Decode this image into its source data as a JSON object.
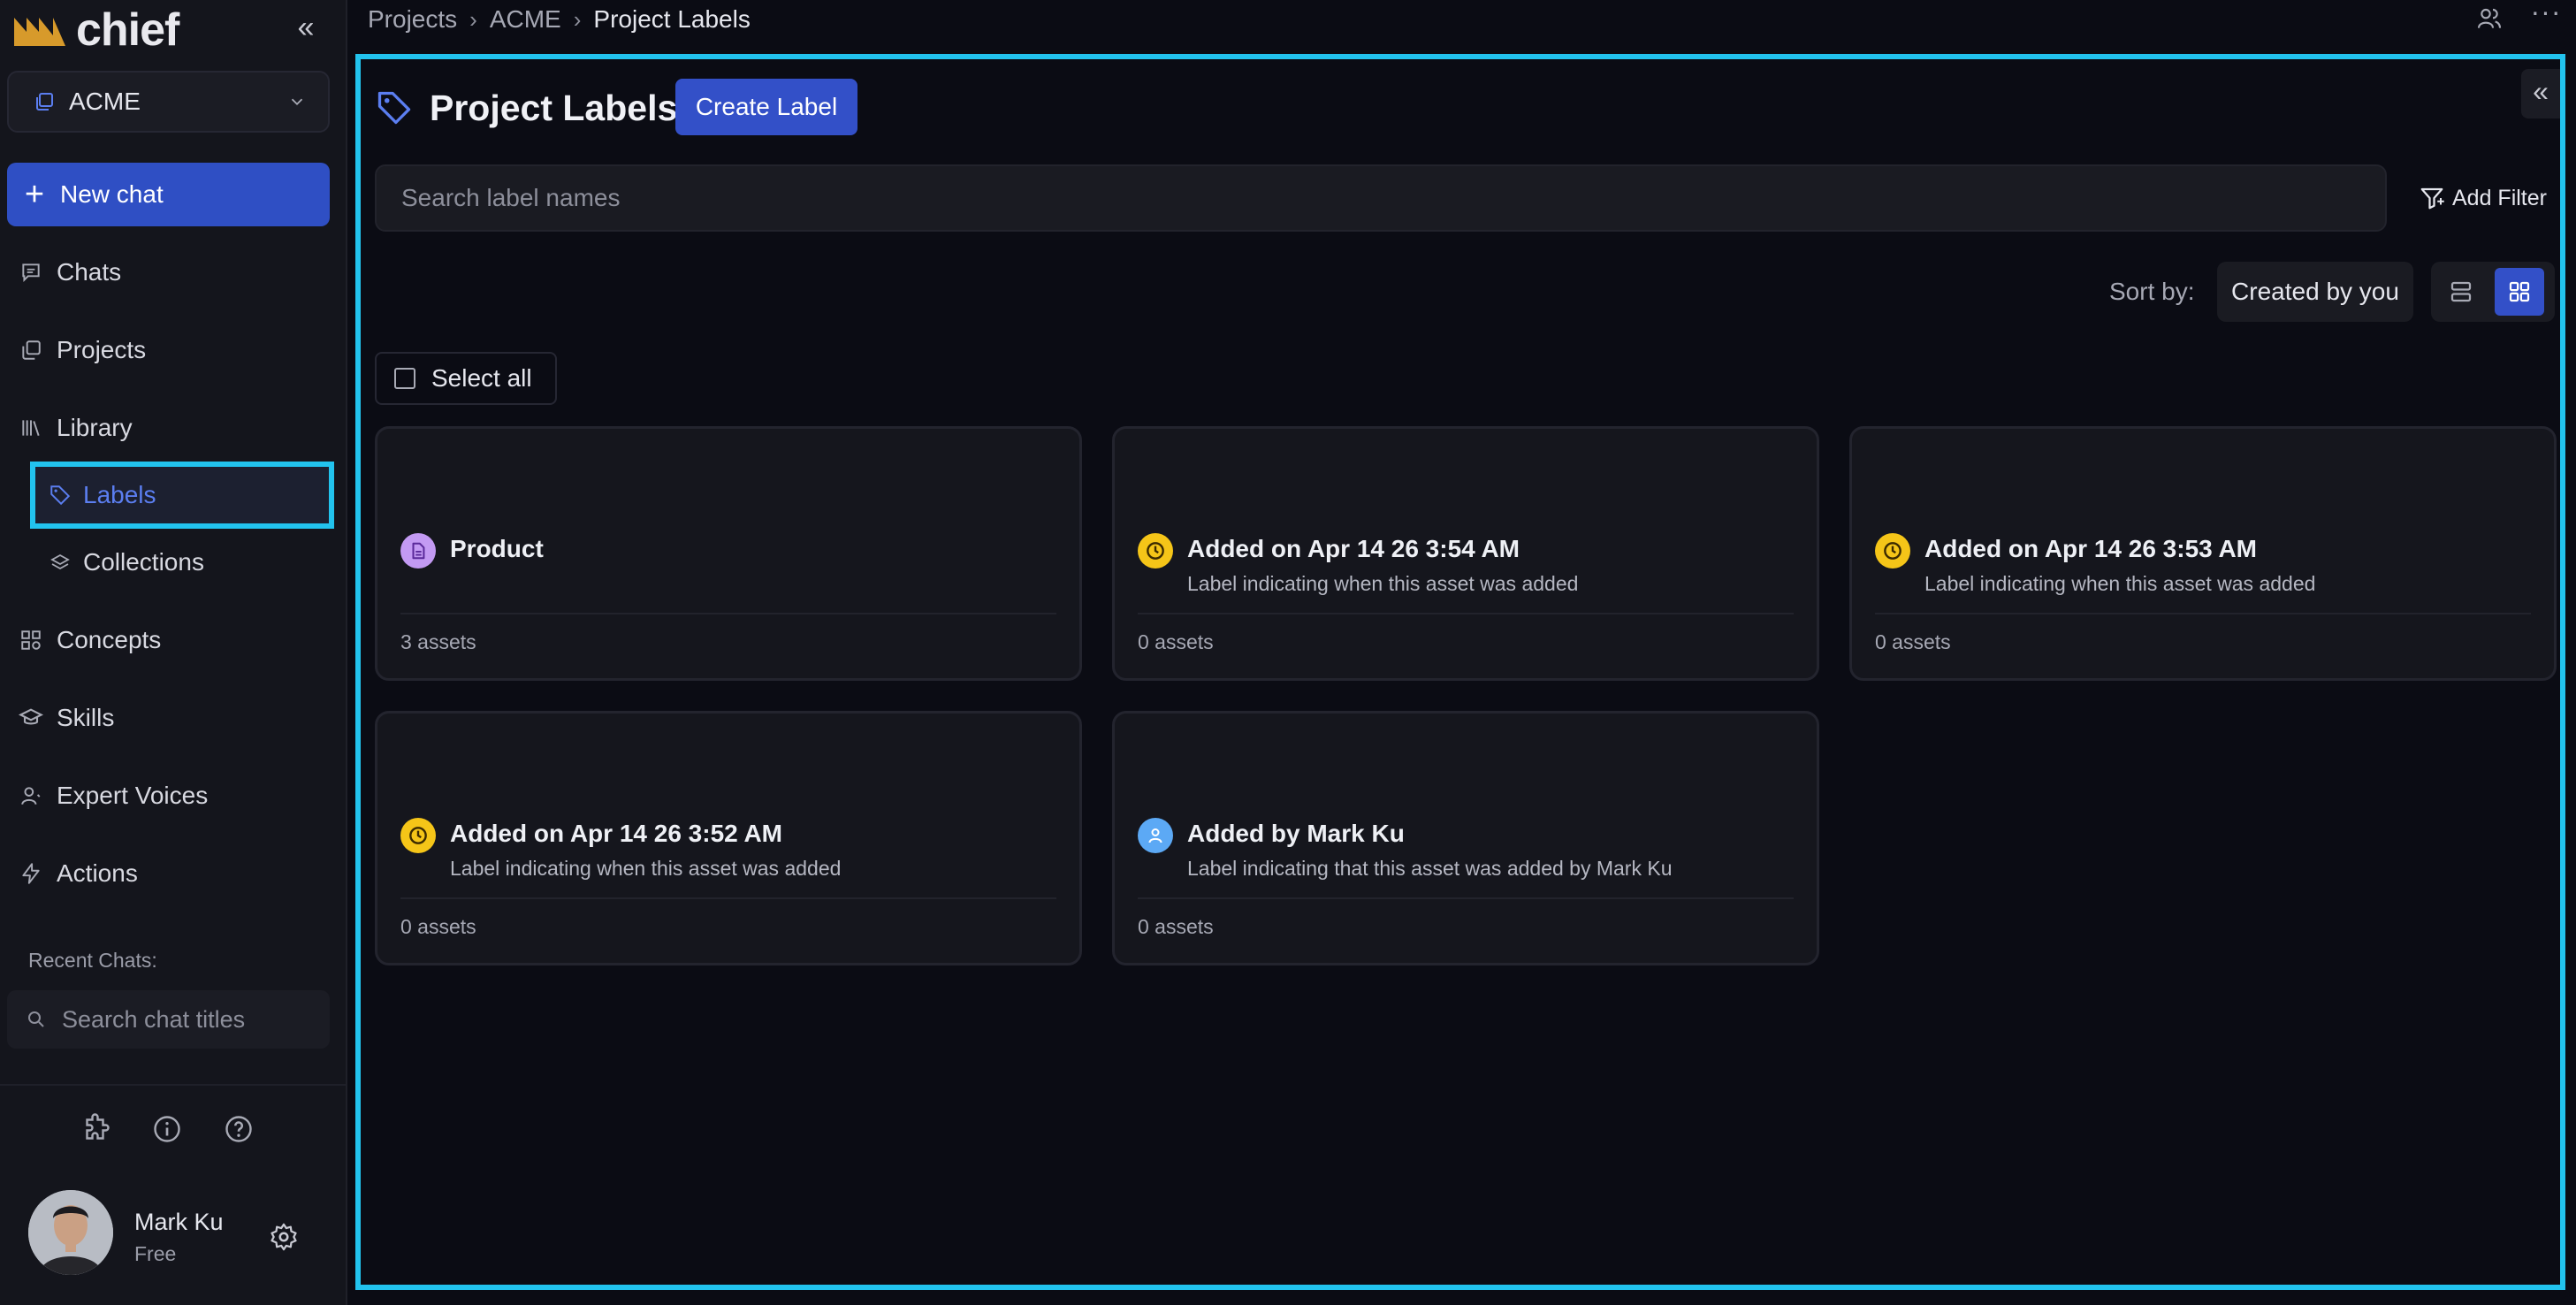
{
  "app": {
    "logo_text": "chief"
  },
  "colors": {
    "accent": "#3350c8",
    "highlight_outline": "#22c3ee",
    "clock_badge": "#f5c518",
    "doc_badge": "#c39af3",
    "user_badge": "#5ca9f5"
  },
  "sidebar": {
    "org_name": "ACME",
    "new_chat_label": "New chat",
    "nav": {
      "chats": "Chats",
      "projects": "Projects",
      "library": "Library",
      "labels": "Labels",
      "collections": "Collections",
      "concepts": "Concepts",
      "skills": "Skills",
      "expert_voices": "Expert Voices",
      "actions": "Actions"
    },
    "recent_chats_label": "Recent Chats:",
    "chat_search_placeholder": "Search chat titles",
    "user": {
      "name": "Mark Ku",
      "plan": "Free"
    }
  },
  "breadcrumb": {
    "items": [
      "Projects",
      "ACME"
    ],
    "current": "Project Labels"
  },
  "main": {
    "title": "Project Labels",
    "create_button": "Create Label",
    "search_placeholder": "Search label names",
    "add_filter": "Add Filter",
    "sort_label": "Sort by:",
    "sort_value": "Created by you",
    "select_all": "Select all",
    "cards": [
      {
        "icon": "document-icon",
        "title": "Product",
        "description": "",
        "count": "3 assets"
      },
      {
        "icon": "clock-icon",
        "title": "Added on Apr 14 26 3:54 AM",
        "description": "Label indicating when this asset was added",
        "count": "0 assets"
      },
      {
        "icon": "clock-icon",
        "title": "Added on Apr 14 26 3:53 AM",
        "description": "Label indicating when this asset was added",
        "count": "0 assets"
      },
      {
        "icon": "clock-icon",
        "title": "Added on Apr 14 26 3:52 AM",
        "description": "Label indicating when this asset was added",
        "count": "0 assets"
      },
      {
        "icon": "user-icon",
        "title": "Added by Mark Ku",
        "description": "Label indicating that this asset was added by Mark Ku",
        "count": "0 assets"
      }
    ]
  }
}
